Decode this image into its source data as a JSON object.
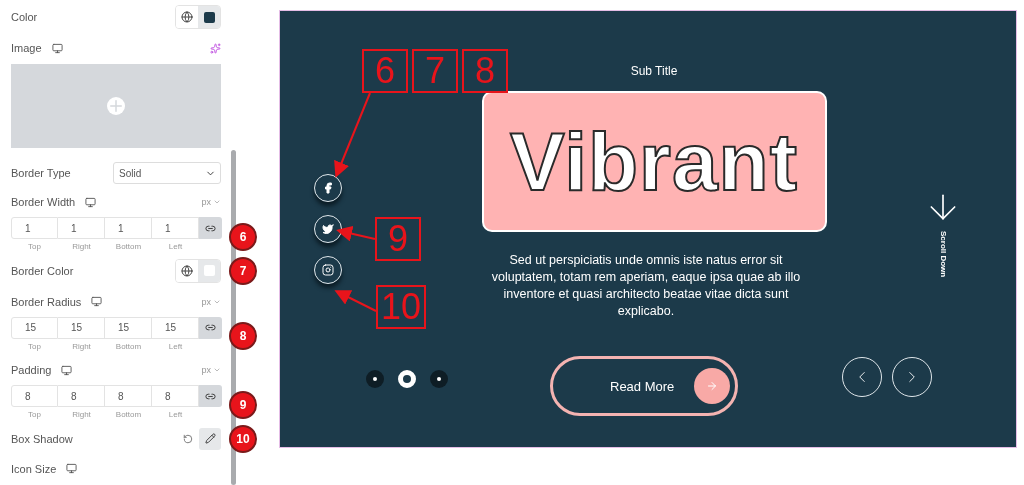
{
  "panel": {
    "controls": [
      {
        "kind": "color",
        "label": "Color",
        "color": "#1c3a4a"
      },
      {
        "kind": "image",
        "label": "Image",
        "responsive": true
      },
      {
        "kind": "select",
        "label": "Border Type",
        "value": "Solid"
      },
      {
        "kind": "dimensions",
        "label": "Border Width",
        "responsive": true,
        "unit": "px",
        "linked": true,
        "badge": "6",
        "fields": [
          {
            "value": "1",
            "label": "Top"
          },
          {
            "value": "1",
            "label": "Right"
          },
          {
            "value": "1",
            "label": "Bottom"
          },
          {
            "value": "1",
            "label": "Left"
          }
        ]
      },
      {
        "kind": "color",
        "label": "Border Color",
        "color": "#ffffff",
        "badge": "7"
      },
      {
        "kind": "dimensions",
        "label": "Border Radius",
        "responsive": true,
        "unit": "px",
        "linked": true,
        "badge": "8",
        "fields": [
          {
            "value": "15",
            "label": "Top"
          },
          {
            "value": "15",
            "label": "Right"
          },
          {
            "value": "15",
            "label": "Bottom"
          },
          {
            "value": "15",
            "label": "Left"
          }
        ]
      },
      {
        "kind": "dimensions",
        "label": "Padding",
        "responsive": true,
        "unit": "px",
        "linked": true,
        "badge": "9",
        "fields": [
          {
            "value": "8",
            "label": "Top"
          },
          {
            "value": "8",
            "label": "Right"
          },
          {
            "value": "8",
            "label": "Bottom"
          },
          {
            "value": "8",
            "label": "Left"
          }
        ]
      },
      {
        "kind": "shadow",
        "label": "Box Shadow",
        "badge": "10"
      },
      {
        "kind": "heading",
        "label": "Icon Size",
        "responsive": true
      }
    ]
  },
  "preview": {
    "subtitle": "Sub Title",
    "title": "Vibrant",
    "text": "Sed ut perspiciatis unde omnis iste natus error sit voluptatem, totam rem aperiam, eaque ipsa quae ab illo inventore et quasi architecto beatae vitae dicta sunt explicabo.",
    "button": "Read More",
    "scroll_label": "Scroll Down",
    "social": [
      {
        "kind": "facebook"
      },
      {
        "kind": "twitter"
      },
      {
        "kind": "instagram"
      }
    ],
    "dots": [
      {
        "selected": false
      },
      {
        "selected": true
      },
      {
        "selected": false
      }
    ],
    "callouts": [
      {
        "labels": [
          "6",
          "7",
          "8"
        ]
      },
      {
        "labels": [
          "9"
        ]
      },
      {
        "labels": [
          "10"
        ]
      }
    ]
  }
}
